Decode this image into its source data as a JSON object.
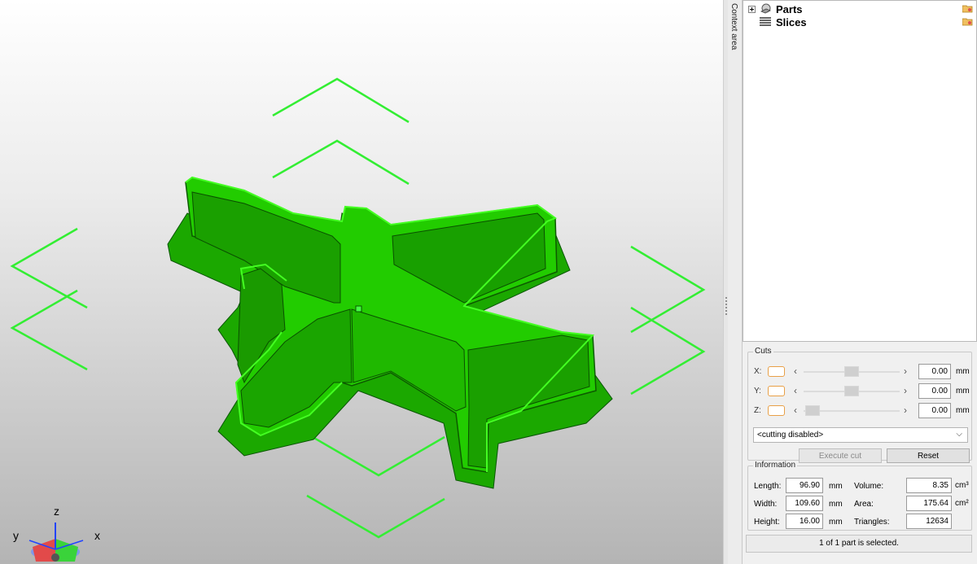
{
  "viewport": {
    "axis_labels": {
      "z": "z",
      "y": "y",
      "x": "x"
    },
    "model_color": "#22dd00",
    "bbox_color": "#33ee33"
  },
  "side_tab": {
    "label": "Context area"
  },
  "tree": {
    "items": [
      {
        "label": "Parts",
        "icon": "parts-icon",
        "expandable": true
      },
      {
        "label": "Slices",
        "icon": "slices-icon",
        "expandable": false
      }
    ]
  },
  "cuts": {
    "title": "Cuts",
    "rows": [
      {
        "axis": "X:",
        "value": "0.00",
        "unit": "mm",
        "slider_fraction": 0.5
      },
      {
        "axis": "Y:",
        "value": "0.00",
        "unit": "mm",
        "slider_fraction": 0.5
      },
      {
        "axis": "Z:",
        "value": "0.00",
        "unit": "mm",
        "slider_fraction": 0.0
      }
    ],
    "mode_select": "<cutting disabled>",
    "execute_label": "Execute cut",
    "reset_label": "Reset"
  },
  "information": {
    "title": "Information",
    "length_label": "Length:",
    "length_value": "96.90",
    "length_unit": "mm",
    "width_label": "Width:",
    "width_value": "109.60",
    "width_unit": "mm",
    "height_label": "Height:",
    "height_value": "16.00",
    "height_unit": "mm",
    "volume_label": "Volume:",
    "volume_value": "8.35",
    "volume_unit": "cm³",
    "area_label": "Area:",
    "area_value": "175.64",
    "area_unit": "cm²",
    "triangles_label": "Triangles:",
    "triangles_value": "12634"
  },
  "status": {
    "text": "1 of 1 part is selected."
  }
}
